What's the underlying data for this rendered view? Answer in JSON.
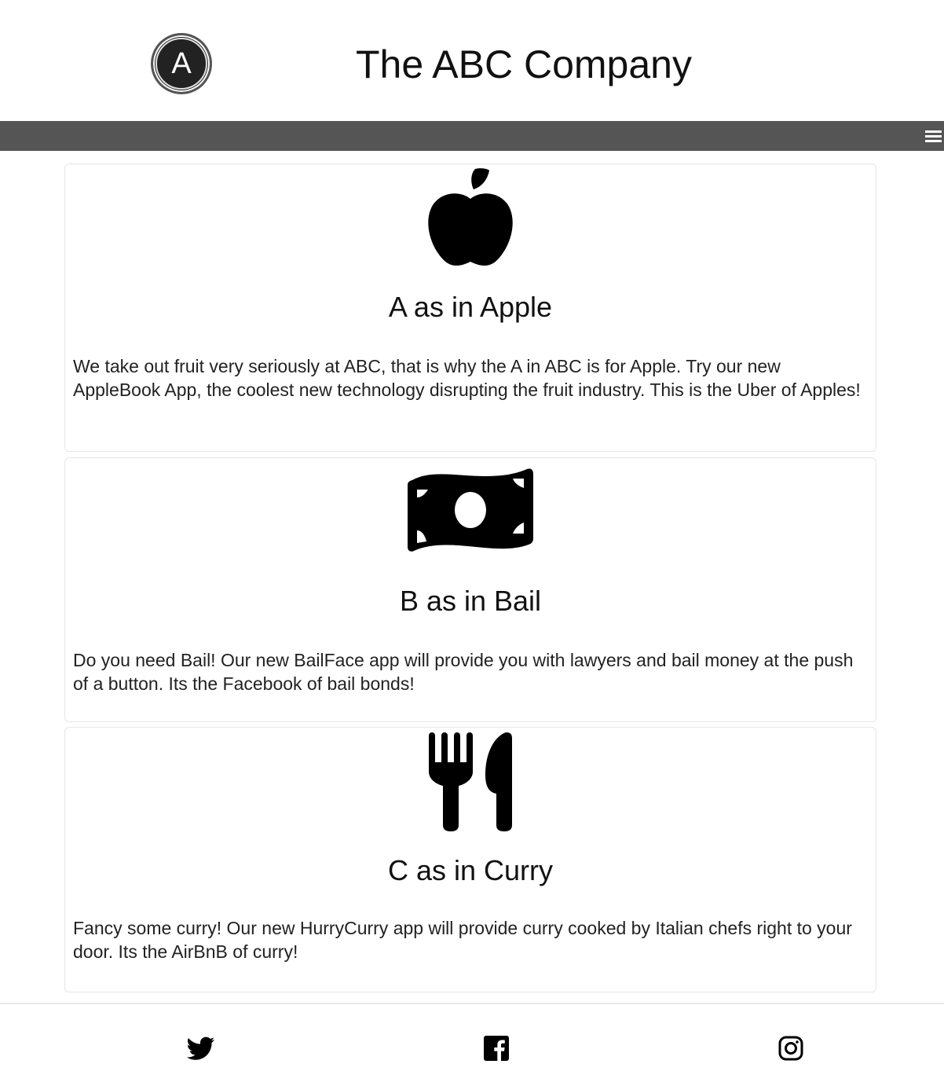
{
  "header": {
    "logo_letter": "A",
    "title": "The ABC Company"
  },
  "navbar": {
    "menu_icon": "hamburger-menu-icon"
  },
  "cards": [
    {
      "icon": "apple-icon",
      "title": "A as in Apple",
      "text": "We take out fruit very seriously at ABC, that is why the A in ABC is for Apple. Try our new AppleBook App, the coolest new technology disrupting the fruit industry. This is the Uber of Apples!"
    },
    {
      "icon": "money-bill-icon",
      "title": "B as in Bail",
      "text": "Do you need Bail! Our new BailFace app will provide you with lawyers and bail money at the push of a button. Its the Facebook of bail bonds!"
    },
    {
      "icon": "fork-knife-icon",
      "title": "C as in Curry",
      "text": "Fancy some curry! Our new HurryCurry app will provide curry cooked by Italian chefs right to your door. Its the AirBnB of curry!"
    }
  ],
  "footer": {
    "links": [
      {
        "icon": "twitter-icon"
      },
      {
        "icon": "facebook-icon"
      },
      {
        "icon": "instagram-icon"
      }
    ]
  }
}
